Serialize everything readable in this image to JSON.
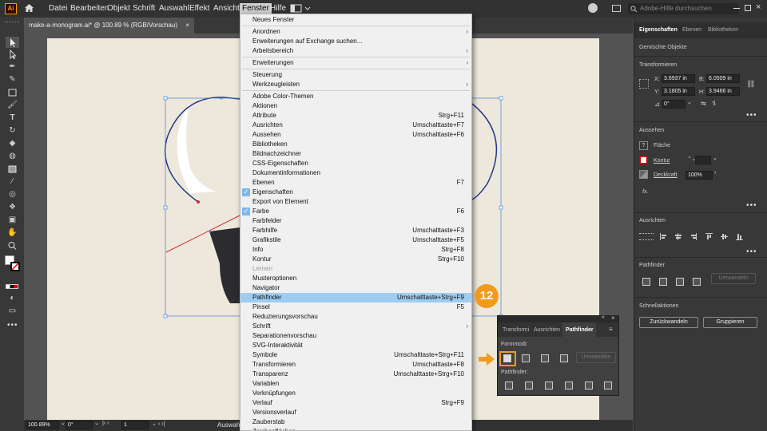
{
  "menubar": {
    "items": [
      "Datei",
      "Bearbeiten",
      "Objekt",
      "Schrift",
      "Auswahl",
      "Effekt",
      "Ansicht",
      "Fenster",
      "Hilfe"
    ],
    "app_logo": "Ai",
    "search_placeholder": "Adobe-Hilfe durchsuchen"
  },
  "document": {
    "tab_title": "make-a-monogram.ai* @ 100.89 % (RGB/Vorschau)",
    "close": "×"
  },
  "statusbar": {
    "zoom": "100.89%",
    "rotation": "0°",
    "artboard": "1",
    "tool": "Auswahl"
  },
  "menu": {
    "items": [
      {
        "label": "Neues Fenster",
        "shortcut": "",
        "arrow": false,
        "checked": false,
        "disabled": false,
        "sep_after": true
      },
      {
        "label": "Anordnen",
        "shortcut": "",
        "arrow": true,
        "checked": false,
        "disabled": false,
        "sep_after": false
      },
      {
        "label": "Erweiterungen auf Exchange suchen...",
        "shortcut": "",
        "arrow": false,
        "checked": false,
        "disabled": false,
        "sep_after": false
      },
      {
        "label": "Arbeitsbereich",
        "shortcut": "",
        "arrow": true,
        "checked": false,
        "disabled": false,
        "sep_after": true
      },
      {
        "label": "Erweiterungen",
        "shortcut": "",
        "arrow": true,
        "checked": false,
        "disabled": false,
        "sep_after": true
      },
      {
        "label": "Steuerung",
        "shortcut": "",
        "arrow": false,
        "checked": false,
        "disabled": false,
        "sep_after": false
      },
      {
        "label": "Werkzeugleisten",
        "shortcut": "",
        "arrow": true,
        "checked": false,
        "disabled": false,
        "sep_after": true
      },
      {
        "label": "Adobe Color-Themen",
        "shortcut": "",
        "arrow": false,
        "checked": false,
        "disabled": false,
        "sep_after": false
      },
      {
        "label": "Aktionen",
        "shortcut": "",
        "arrow": false,
        "checked": false,
        "disabled": false,
        "sep_after": false
      },
      {
        "label": "Attribute",
        "shortcut": "Strg+F11",
        "arrow": false,
        "checked": false,
        "disabled": false,
        "sep_after": false
      },
      {
        "label": "Ausrichten",
        "shortcut": "Umschalttaste+F7",
        "arrow": false,
        "checked": false,
        "disabled": false,
        "sep_after": false
      },
      {
        "label": "Aussehen",
        "shortcut": "Umschalttaste+F6",
        "arrow": false,
        "checked": false,
        "disabled": false,
        "sep_after": false
      },
      {
        "label": "Bibliotheken",
        "shortcut": "",
        "arrow": false,
        "checked": false,
        "disabled": false,
        "sep_after": false
      },
      {
        "label": "Bildnachzeichner",
        "shortcut": "",
        "arrow": false,
        "checked": false,
        "disabled": false,
        "sep_after": false
      },
      {
        "label": "CSS-Eigenschaften",
        "shortcut": "",
        "arrow": false,
        "checked": false,
        "disabled": false,
        "sep_after": false
      },
      {
        "label": "Dokumentinformationen",
        "shortcut": "",
        "arrow": false,
        "checked": false,
        "disabled": false,
        "sep_after": false
      },
      {
        "label": "Ebenen",
        "shortcut": "F7",
        "arrow": false,
        "checked": false,
        "disabled": false,
        "sep_after": false
      },
      {
        "label": "Eigenschaften",
        "shortcut": "",
        "arrow": false,
        "checked": true,
        "disabled": false,
        "sep_after": false
      },
      {
        "label": "Export von Element",
        "shortcut": "",
        "arrow": false,
        "checked": false,
        "disabled": false,
        "sep_after": false
      },
      {
        "label": "Farbe",
        "shortcut": "F6",
        "arrow": false,
        "checked": true,
        "disabled": false,
        "sep_after": false
      },
      {
        "label": "Farbfelder",
        "shortcut": "",
        "arrow": false,
        "checked": false,
        "disabled": false,
        "sep_after": false
      },
      {
        "label": "Farbhilfe",
        "shortcut": "Umschalttaste+F3",
        "arrow": false,
        "checked": false,
        "disabled": false,
        "sep_after": false
      },
      {
        "label": "Grafikstile",
        "shortcut": "Umschalttaste+F5",
        "arrow": false,
        "checked": false,
        "disabled": false,
        "sep_after": false
      },
      {
        "label": "Info",
        "shortcut": "Strg+F8",
        "arrow": false,
        "checked": false,
        "disabled": false,
        "sep_after": false
      },
      {
        "label": "Kontur",
        "shortcut": "Strg+F10",
        "arrow": false,
        "checked": false,
        "disabled": false,
        "sep_after": false
      },
      {
        "label": "Lernen",
        "shortcut": "",
        "arrow": false,
        "checked": false,
        "disabled": true,
        "sep_after": false
      },
      {
        "label": "Musteroptionen",
        "shortcut": "",
        "arrow": false,
        "checked": false,
        "disabled": false,
        "sep_after": false
      },
      {
        "label": "Navigator",
        "shortcut": "",
        "arrow": false,
        "checked": false,
        "disabled": false,
        "sep_after": false
      },
      {
        "label": "Pathfinder",
        "shortcut": "Umschalttaste+Strg+F9",
        "arrow": false,
        "checked": false,
        "disabled": false,
        "sep_after": false,
        "highlight": true
      },
      {
        "label": "Pinsel",
        "shortcut": "F5",
        "arrow": false,
        "checked": false,
        "disabled": false,
        "sep_after": false
      },
      {
        "label": "Reduzierungsvorschau",
        "shortcut": "",
        "arrow": false,
        "checked": false,
        "disabled": false,
        "sep_after": false
      },
      {
        "label": "Schrift",
        "shortcut": "",
        "arrow": true,
        "checked": false,
        "disabled": false,
        "sep_after": false
      },
      {
        "label": "Separationenvorschau",
        "shortcut": "",
        "arrow": false,
        "checked": false,
        "disabled": false,
        "sep_after": false
      },
      {
        "label": "SVG-Interaktivität",
        "shortcut": "",
        "arrow": false,
        "checked": false,
        "disabled": false,
        "sep_after": false
      },
      {
        "label": "Symbole",
        "shortcut": "Umschalttaste+Strg+F11",
        "arrow": false,
        "checked": false,
        "disabled": false,
        "sep_after": false
      },
      {
        "label": "Transformieren",
        "shortcut": "Umschalttaste+F8",
        "arrow": false,
        "checked": false,
        "disabled": false,
        "sep_after": false
      },
      {
        "label": "Transparenz",
        "shortcut": "Umschalttaste+Strg+F10",
        "arrow": false,
        "checked": false,
        "disabled": false,
        "sep_after": false
      },
      {
        "label": "Variablen",
        "shortcut": "",
        "arrow": false,
        "checked": false,
        "disabled": false,
        "sep_after": false
      },
      {
        "label": "Verknüpfungen",
        "shortcut": "",
        "arrow": false,
        "checked": false,
        "disabled": false,
        "sep_after": false
      },
      {
        "label": "Verlauf",
        "shortcut": "Strg+F9",
        "arrow": false,
        "checked": false,
        "disabled": false,
        "sep_after": false
      },
      {
        "label": "Versionsverlauf",
        "shortcut": "",
        "arrow": false,
        "checked": false,
        "disabled": false,
        "sep_after": false
      },
      {
        "label": "Zauberstab",
        "shortcut": "",
        "arrow": false,
        "checked": false,
        "disabled": false,
        "sep_after": false
      },
      {
        "label": "Zeichenflächen",
        "shortcut": "",
        "arrow": false,
        "checked": false,
        "disabled": false,
        "sep_after": false
      }
    ]
  },
  "step_badge": "12",
  "pathfinder_panel": {
    "tabs": [
      "Transformi",
      "Ausrichten",
      "Pathfinder"
    ],
    "formmodi_label": "Formmodi:",
    "pathfinder_label": "Pathfinder:",
    "expand_button": "Umwandeln"
  },
  "rpanel": {
    "tabs": [
      "Eigenschaften",
      "Ebenen",
      "Bibliotheken"
    ],
    "object_type": "Gemischte Objekte",
    "transform_title": "Transformieren",
    "x_label": "X:",
    "x_value": "3.6937 in",
    "y_label": "Y:",
    "y_value": "3.1805 in",
    "b_label": "B:",
    "b_value": "6.0509 in",
    "h_label": "H:",
    "h_value": "3.9466 in",
    "angle_value": "0°",
    "appearance_title": "Aussehen",
    "fill_label": "Fläche",
    "stroke_label": "Kontur",
    "opacity_label": "Deckkraft",
    "opacity_value": "100%",
    "fx_label": "fx.",
    "align_title": "Ausrichten",
    "pathfinder_title": "Pathfinder",
    "pathfinder_expand": "Umwandeln",
    "quick_title": "Schnellaktionen",
    "ungroup_button": "Zurückwandeln",
    "group_button": "Gruppieren"
  },
  "colors": {
    "accent_highlight": "#9fcdf2",
    "step_badge": "#f29a1d",
    "path_blue": "#1f3a8a",
    "anchor_red": "#d12a2a",
    "artboard": "#ede8db"
  }
}
